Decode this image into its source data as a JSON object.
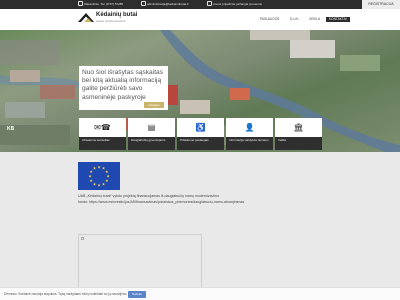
{
  "topbar": {
    "address": "Vaiesvitinio. Tel. (8 57) 57286",
    "email": "administracija@kedainiubutai.lt",
    "notice": "Įmonė pripažinta pažangia įmonėmis",
    "registration_button": "REGISTRACIJA"
  },
  "header": {
    "logo_title": "Kėdainių butai",
    "logo_subtitle": "pastatų priežiūra bendrovė",
    "nav": [
      "PASLAUGOS",
      "D.U.K.",
      "VEIKLA",
      "KONTAKTAI"
    ]
  },
  "hero": {
    "card_text": "Nuo šiol išrašytas sąskaitas bei kitą aktualią informaciją galite peržiūrėti savo asmeninėje paskyroje",
    "card_button": "Daugiau",
    "logo_text": "KB"
  },
  "tiles": [
    {
      "icon": "✉☎",
      "icon_name": "mail-phone-icon",
      "label": "Užsakome konsultac."
    },
    {
      "icon": "▤",
      "icon_name": "building-icon",
      "label": "Daugiabučių gyventojams"
    },
    {
      "icon": "♿",
      "icon_name": "accessibility-icon",
      "label": "Pritaikome paslaugas"
    },
    {
      "icon": "👤",
      "icon_name": "person-icon",
      "label": "Informacija valstybės tarnams"
    },
    {
      "icon": "🏛",
      "icon_name": "institution-icon",
      "label": "Veikla"
    }
  ],
  "eu": {
    "line1": "UAB „Kėdainių butai“ vykdo projektą finansuojamas iš daugiabučių namų modernizavimo",
    "line2": "fondo: https://www.esinvesticijos.lt/lt/finansavimas/paraiskos_priemones/daugiabuciu-namu-atnaujinimas"
  },
  "cookie": {
    "text": "Dėmesio: Svetainė naudoja slapukus. Tęsę naršydami mūsų sutinkate su jų naudojimu.",
    "button": "Sutinku"
  },
  "colors": {
    "dark": "#2d2d2d",
    "accent": "#c9b46a",
    "eu_blue": "#1f49b0",
    "cookie_button": "#5a86c8"
  }
}
